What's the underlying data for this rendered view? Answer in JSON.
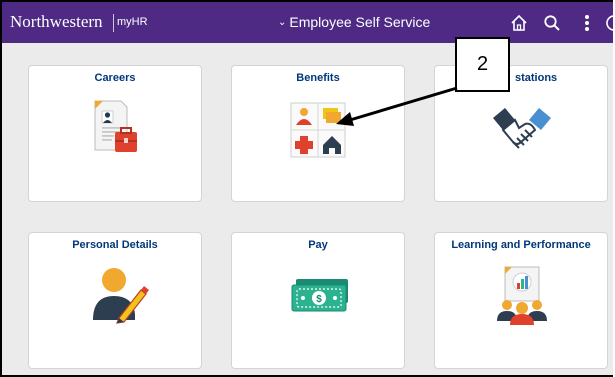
{
  "header": {
    "brand_name": "Northwestern",
    "brand_sub": "myHR",
    "homepage_title": "Employee Self Service",
    "icons": [
      "home-icon",
      "search-icon",
      "more-options-icon"
    ],
    "colors": {
      "bar": "#4e2a84",
      "tile_title": "#00387a",
      "background": "#ebebeb"
    }
  },
  "tiles": [
    {
      "title": "Careers",
      "icon": "careers-resume-icon"
    },
    {
      "title": "Benefits",
      "icon": "benefits-icon"
    },
    {
      "title": "Affiliations",
      "visible_title": "stations",
      "icon": "handshake-icon"
    },
    {
      "title": "Personal Details",
      "icon": "personal-details-icon"
    },
    {
      "title": "Pay",
      "icon": "pay-money-icon"
    },
    {
      "title": "Learning and Performance",
      "icon": "learning-performance-icon"
    }
  ],
  "annotation": {
    "callout_number": "2",
    "target": "Benefits"
  }
}
